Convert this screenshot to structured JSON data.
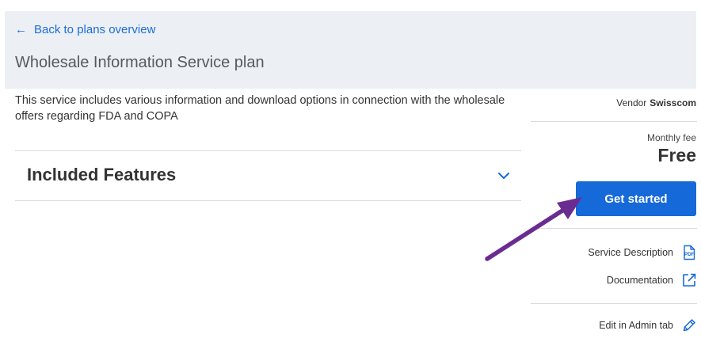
{
  "header": {
    "back_link": "Back to plans overview",
    "plan_title": "Wholesale Information Service plan"
  },
  "main": {
    "description": "This service includes various information and download options in connection with the wholesale offers regarding FDA and COPA",
    "features_title": "Included Features"
  },
  "sidebar": {
    "vendor_label": "Vendor",
    "vendor_name": "Swisscom",
    "fee_label": "Monthly fee",
    "fee_value": "Free",
    "cta_label": "Get started",
    "service_description_label": "Service Description",
    "documentation_label": "Documentation",
    "edit_label": "Edit in Admin tab"
  },
  "icons": {
    "back": "arrow-left-icon",
    "expand": "chevron-down-icon",
    "pdf": "pdf-icon",
    "external": "external-link-icon",
    "edit": "pencil-icon"
  },
  "colors": {
    "accent": "#1669d9",
    "header_bg": "#eceff3",
    "annotation": "#6a2c91"
  }
}
